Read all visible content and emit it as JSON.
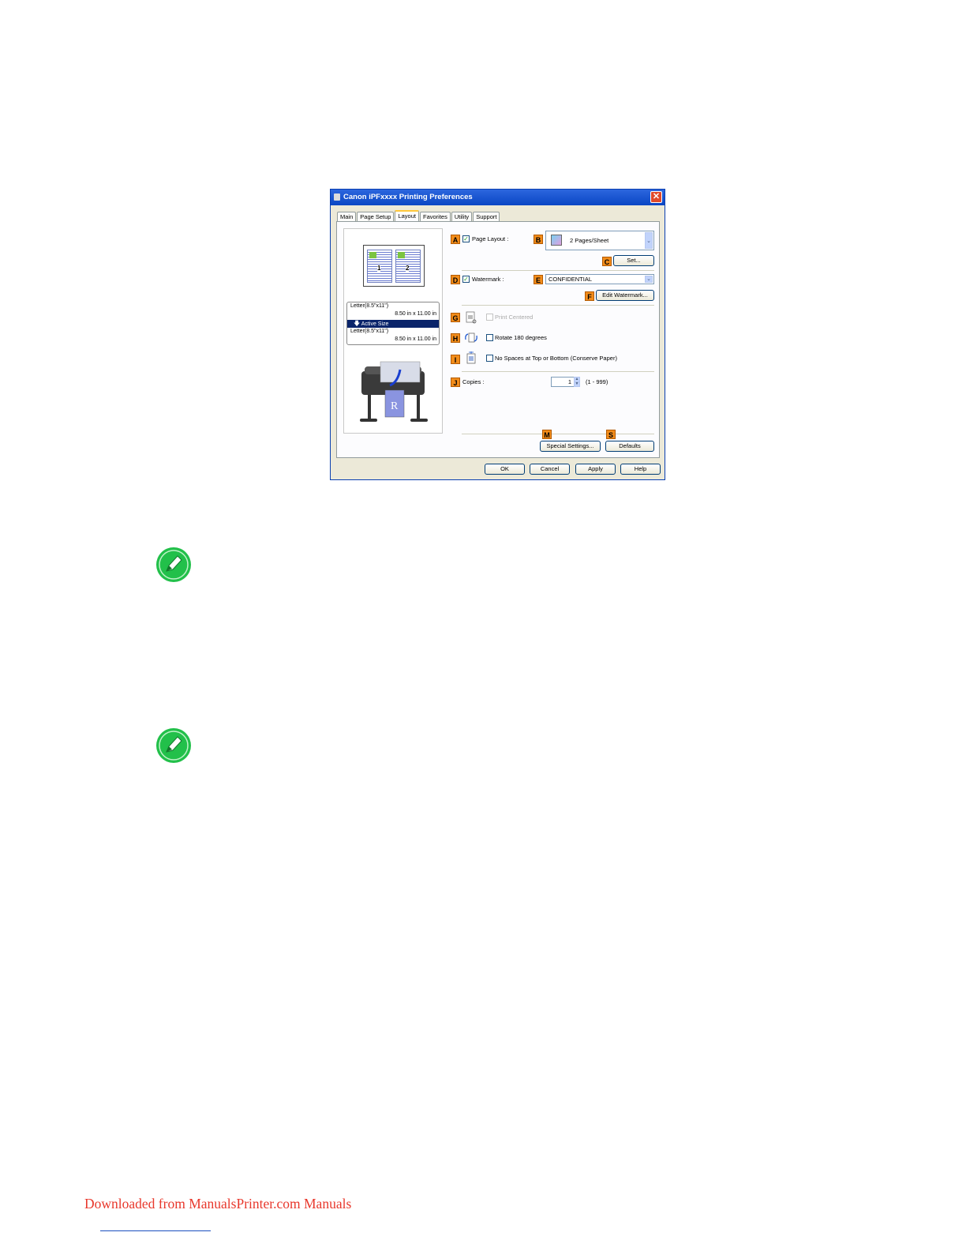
{
  "dialog": {
    "title": "Canon iPFxxxx Printing Preferences",
    "close_glyph": "✕",
    "tabs": [
      "Main",
      "Page Setup",
      "Layout",
      "Favorites",
      "Utility",
      "Support"
    ],
    "active_tab": "Layout"
  },
  "preview": {
    "page1": "1",
    "page2": "2",
    "original_size": "Letter(8.5\"x11\")",
    "original_dims": "8.50 in x 11.00 in",
    "active_size_label": "Active Size",
    "output_size": "Letter(8.5\"x11\")",
    "output_dims": "8.50 in x 11.00 in",
    "printer_paper_glyph": "R"
  },
  "badges": {
    "a": "A",
    "b": "B",
    "c": "C",
    "d": "D",
    "e": "E",
    "f": "F",
    "g": "G",
    "h": "H",
    "i": "I",
    "j": "J",
    "m": "M",
    "s": "S"
  },
  "controls": {
    "page_layout_label": "Page Layout :",
    "page_layout_checked": true,
    "page_layout_value": "2 Pages/Sheet",
    "set_button": "Set...",
    "watermark_label": "Watermark :",
    "watermark_checked": true,
    "watermark_value": "CONFIDENTIAL",
    "edit_watermark_button": "Edit Watermark...",
    "print_centered_label": "Print Centered",
    "rotate_label": "Rotate 180 degrees",
    "no_spaces_label": "No Spaces at Top or Bottom (Conserve Paper)",
    "copies_label": "Copies :",
    "copies_value": "1",
    "copies_range": "(1 - 999)",
    "special_settings_button": "Special Settings...",
    "defaults_button": "Defaults",
    "check_glyph": "✓",
    "dropdown_glyph": "⌄"
  },
  "buttons": {
    "ok": "OK",
    "cancel": "Cancel",
    "apply": "Apply",
    "help": "Help"
  },
  "icons": {
    "note_1": "note-pencil-icon",
    "note_2": "note-pencil-icon"
  },
  "colors": {
    "badge": "#f28c1a",
    "note_green": "#22c04a",
    "link_red": "#e8382c"
  },
  "footer": {
    "link_text": "Downloaded from ManualsPrinter.com Manuals"
  }
}
